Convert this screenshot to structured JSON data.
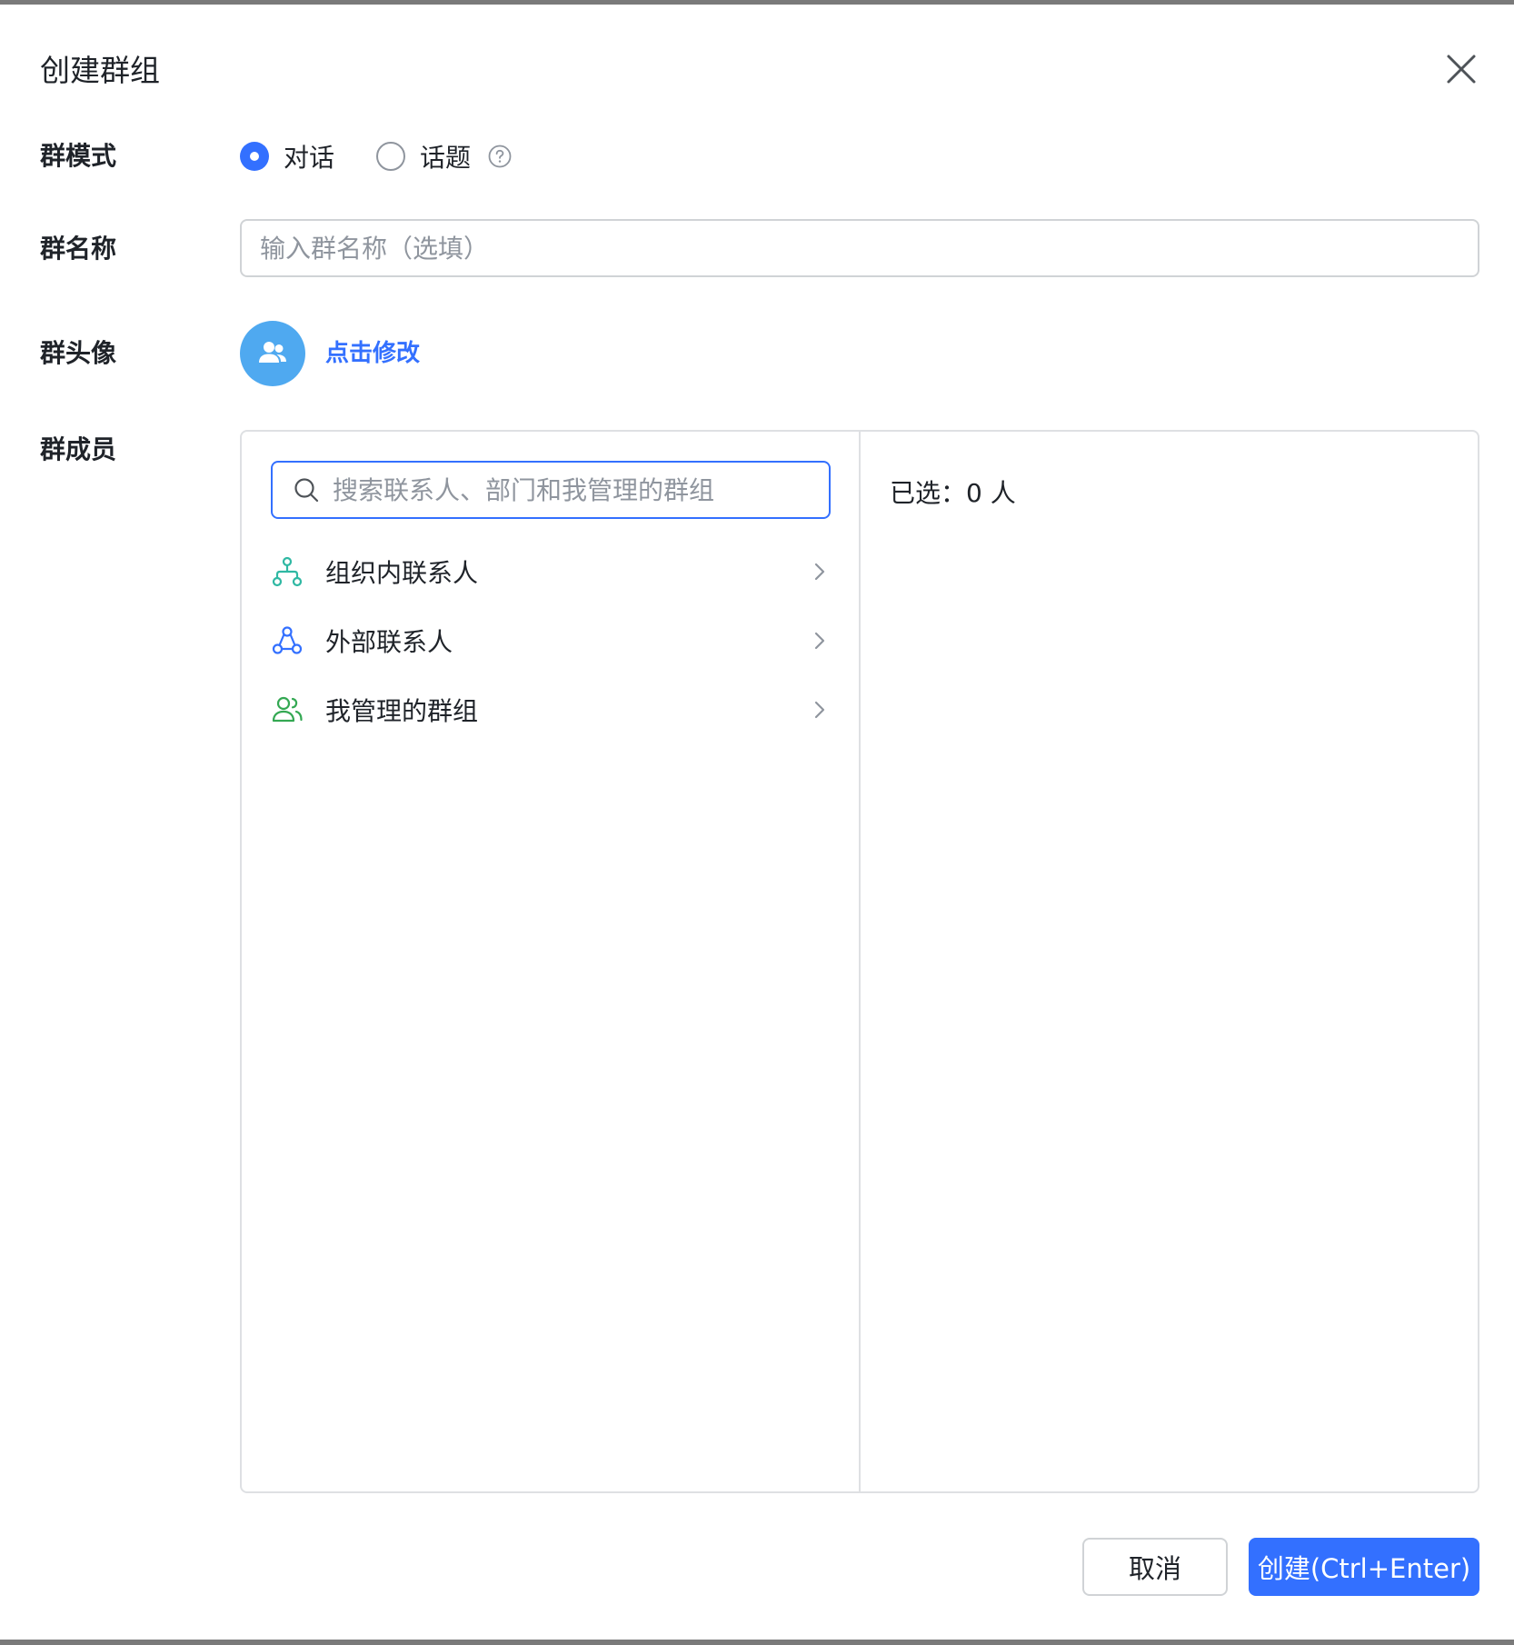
{
  "dialog": {
    "title": "创建群组"
  },
  "mode": {
    "label": "群模式",
    "options": [
      {
        "label": "对话",
        "checked": true
      },
      {
        "label": "话题",
        "checked": false
      }
    ],
    "help_icon": "question-circle-icon"
  },
  "name": {
    "label": "群名称",
    "value": "",
    "placeholder": "输入群名称（选填）"
  },
  "avatar": {
    "label": "群头像",
    "icon": "group-users-icon",
    "color": "#4fa9f0",
    "action_label": "点击修改"
  },
  "members": {
    "label": "群成员",
    "search": {
      "value": "",
      "placeholder": "搜索联系人、部门和我管理的群组"
    },
    "sources": [
      {
        "label": "组织内联系人",
        "icon": "org-tree-icon",
        "color": "#2fb8a3"
      },
      {
        "label": "外部联系人",
        "icon": "external-contacts-icon",
        "color": "#3370ff"
      },
      {
        "label": "我管理的群组",
        "icon": "managed-groups-icon",
        "color": "#34a853"
      }
    ],
    "selected_label": "已选：0 人"
  },
  "footer": {
    "cancel_label": "取消",
    "create_label": "创建(Ctrl+Enter)"
  },
  "colors": {
    "accent": "#3370ff",
    "border": "#dee0e3",
    "text": "#1f2329",
    "placeholder": "#8f959e"
  }
}
